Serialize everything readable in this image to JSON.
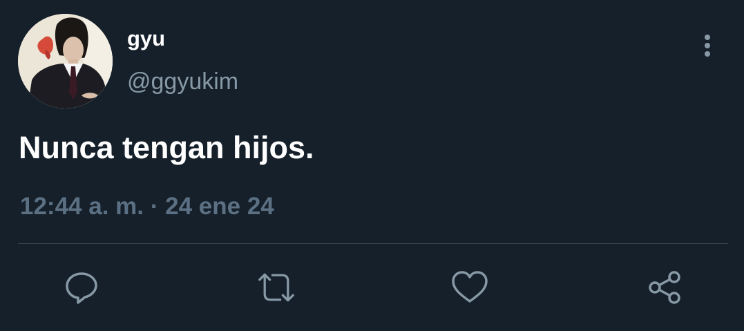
{
  "tweet": {
    "display_name": "gyu",
    "handle": "@ggyukim",
    "text": "Nunca tengan hijos.",
    "time": "12:44 a. m.",
    "separator": "·",
    "date": "24 ene 24"
  },
  "icons": {
    "more": "more-vertical-icon",
    "reply": "reply-icon",
    "retweet": "retweet-icon",
    "like": "like-icon",
    "share": "share-icon"
  },
  "colors": {
    "background": "#15202b",
    "text_primary": "#ffffff",
    "text_secondary": "#8899a6",
    "meta": "#5b7083",
    "divider": "#38444d"
  }
}
